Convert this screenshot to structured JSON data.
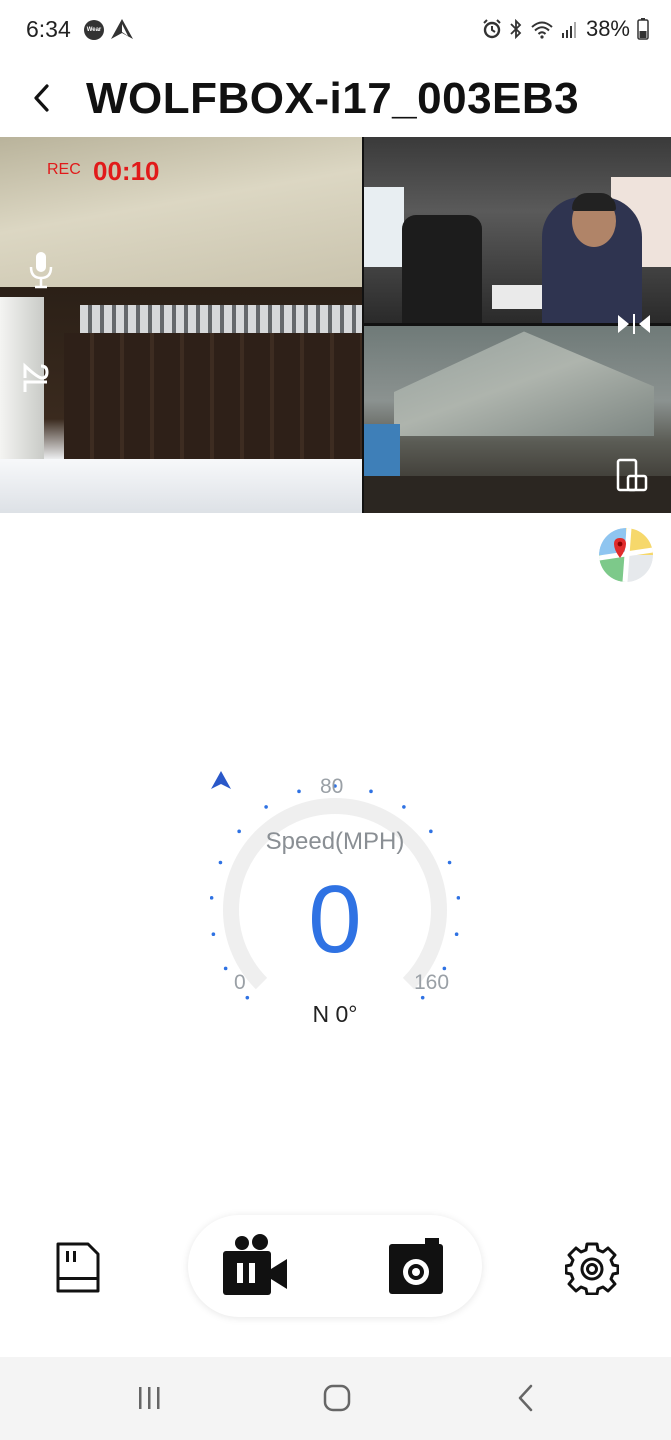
{
  "status_bar": {
    "time": "6:34",
    "wear_badge": "Wear",
    "battery_percent": "38%"
  },
  "header": {
    "title": "WOLFBOX-i17_003EB3"
  },
  "recording": {
    "rec_label": "REC",
    "timer": "00:10"
  },
  "gauge": {
    "label": "Speed(MPH)",
    "speed": "0",
    "tick_min": "0",
    "tick_mid": "80",
    "tick_max": "160",
    "heading": "N 0°",
    "max_speed": 160
  },
  "colors": {
    "accent_blue": "#2f72e3",
    "rec_red": "#e11a1a"
  },
  "icons": {
    "back": "back-icon",
    "mic": "mic-icon",
    "resolution": "resolution-icon",
    "swap": "swap-view-icon",
    "rotate": "rotate-screen-icon",
    "map": "map-icon",
    "sdcard": "sd-card-icon",
    "record": "record-pause-icon",
    "snapshot": "camera-icon",
    "settings": "gear-icon"
  }
}
